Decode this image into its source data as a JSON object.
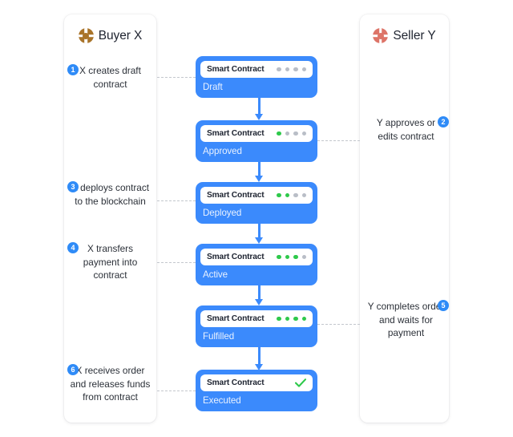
{
  "page": {
    "background": "#ffffff",
    "accent_blue": "#3b8afc",
    "badge_blue": "#2f8bf7",
    "dot_green": "#2ec94b",
    "dot_gray": "#b9bec7",
    "connector_gray": "#c3c7cd"
  },
  "parties": {
    "buyer": {
      "title": "Buyer X",
      "icon": "buyer-avatar-icon",
      "icon_color": "#a9742a"
    },
    "seller": {
      "title": "Seller Y",
      "icon": "seller-avatar-icon",
      "icon_color": "#dd7468"
    }
  },
  "steps": [
    {
      "number": "1",
      "side": "buyer",
      "text": "X creates draft contract"
    },
    {
      "number": "2",
      "side": "seller",
      "text": "Y approves or edits contract"
    },
    {
      "number": "3",
      "side": "buyer",
      "text": "X deploys contract to the blockchain"
    },
    {
      "number": "4",
      "side": "buyer",
      "text": "X transfers payment into contract"
    },
    {
      "number": "5",
      "side": "seller",
      "text": "Y completes order and waits for payment"
    },
    {
      "number": "6",
      "side": "buyer",
      "text": "X receives order and releases funds from contract"
    }
  ],
  "cards": [
    {
      "label": "Smart Contract",
      "status": "Draft",
      "dots_on": 0,
      "dots_total": 4,
      "complete": false
    },
    {
      "label": "Smart Contract",
      "status": "Approved",
      "dots_on": 1,
      "dots_total": 4,
      "complete": false
    },
    {
      "label": "Smart Contract",
      "status": "Deployed",
      "dots_on": 2,
      "dots_total": 4,
      "complete": false
    },
    {
      "label": "Smart Contract",
      "status": "Active",
      "dots_on": 3,
      "dots_total": 4,
      "complete": false
    },
    {
      "label": "Smart Contract",
      "status": "Fulfilled",
      "dots_on": 4,
      "dots_total": 4,
      "complete": false
    },
    {
      "label": "Smart Contract",
      "status": "Executed",
      "dots_on": 4,
      "dots_total": 4,
      "complete": true
    }
  ]
}
